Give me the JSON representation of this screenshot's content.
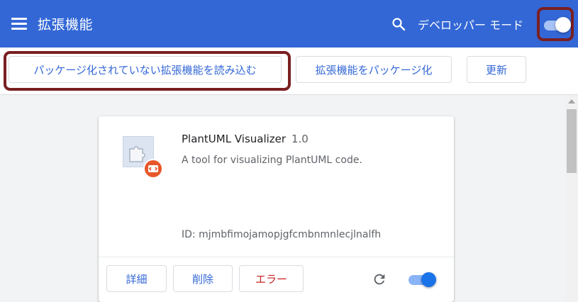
{
  "header": {
    "title": "拡張機能",
    "search_icon": "search-icon",
    "dev_mode_label": "デベロッパー モード",
    "dev_mode_on": true,
    "background_color": "#3367d6"
  },
  "toolbar": {
    "load_unpacked_label": "パッケージ化されていない拡張機能を読み込む",
    "pack_label": "拡張機能をパッケージ化",
    "update_label": "更新"
  },
  "extension": {
    "name": "PlantUML Visualizer",
    "version": "1.0",
    "description": "A tool for visualizing PlantUML code.",
    "id_text": "ID: mjmbfimojamopjgfcmbnmnlecjlnalfh",
    "details_label": "詳細",
    "remove_label": "削除",
    "errors_label": "エラー",
    "enabled": true,
    "error_color": "#c5221f",
    "accent_color": "#1a73e8"
  }
}
